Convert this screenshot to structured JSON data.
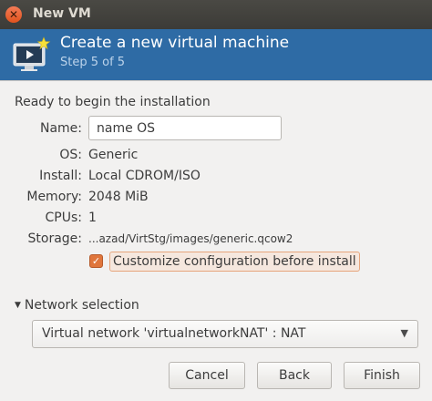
{
  "window": {
    "title": "New VM",
    "close_glyph": "✕"
  },
  "banner": {
    "title": "Create a new virtual machine",
    "step": "Step 5 of 5",
    "icon": "vm-monitor-icon"
  },
  "summary": {
    "heading": "Ready to begin the installation",
    "name_label": "Name:",
    "name_value": "name OS",
    "os_label": "OS:",
    "os_value": "Generic",
    "install_label": "Install:",
    "install_value": "Local CDROM/ISO",
    "memory_label": "Memory:",
    "memory_value": "2048 MiB",
    "cpus_label": "CPUs:",
    "cpus_value": "1",
    "storage_label": "Storage:",
    "storage_value": "...azad/VirtStg/images/generic.qcow2"
  },
  "customize": {
    "label": "Customize configuration before install",
    "checked": true,
    "check_glyph": "✓"
  },
  "network": {
    "expander_glyph": "▼",
    "expander_label": "Network selection",
    "selected": "Virtual network 'virtualnetworkNAT' : NAT",
    "arrow_glyph": "▼"
  },
  "buttons": {
    "cancel": "Cancel",
    "back": "Back",
    "finish": "Finish"
  },
  "colors": {
    "banner": "#2e6ba5",
    "accent": "#e0763c",
    "titlebar": "#3c3b37"
  }
}
